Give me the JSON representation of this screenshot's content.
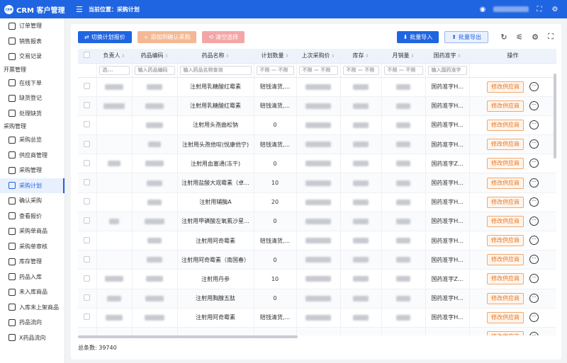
{
  "app": {
    "title": "CRM 客户管理",
    "logo_text": "CRM"
  },
  "breadcrumb": "当前位置：采购计划",
  "sidebar": {
    "top_items": [
      {
        "label": "订单管理",
        "name": "sidebar-item-order-management"
      },
      {
        "label": "销售报表",
        "name": "sidebar-item-sales-report"
      },
      {
        "label": "交易记录",
        "name": "sidebar-item-transaction-records"
      }
    ],
    "group1": "开票管理",
    "group1_items": [
      {
        "label": "在线下单",
        "name": "sidebar-item-online-order"
      },
      {
        "label": "缺货登记",
        "name": "sidebar-item-stockout-register"
      },
      {
        "label": "处理缺货",
        "name": "sidebar-item-handle-stockout"
      }
    ],
    "group2": "采购管理",
    "group2_items": [
      {
        "label": "采购总览",
        "name": "sidebar-item-purchase-overview"
      },
      {
        "label": "供应商管理",
        "name": "sidebar-item-supplier-management"
      },
      {
        "label": "采购管理",
        "name": "sidebar-item-purchase-management"
      },
      {
        "label": "采购计划",
        "name": "sidebar-item-purchase-plan",
        "active": true
      },
      {
        "label": "确认采购",
        "name": "sidebar-item-confirm-purchase"
      },
      {
        "label": "查看报价",
        "name": "sidebar-item-view-quotes"
      },
      {
        "label": "采购单商品",
        "name": "sidebar-item-purchase-order-goods"
      },
      {
        "label": "采购单审核",
        "name": "sidebar-item-purchase-order-review"
      },
      {
        "label": "库存管理",
        "name": "sidebar-item-inventory"
      },
      {
        "label": "药品入库",
        "name": "sidebar-item-drug-inbound"
      },
      {
        "label": "未入库商品",
        "name": "sidebar-item-not-inbound"
      },
      {
        "label": "入库未上架商品",
        "name": "sidebar-item-inbound-not-shelved"
      },
      {
        "label": "药品流向",
        "name": "sidebar-item-drug-flow"
      },
      {
        "label": "X药品流向",
        "name": "sidebar-item-x-drug-flow"
      }
    ]
  },
  "toolbar": {
    "switch_quote": "切换计划报价",
    "add_confirm": "添加到确认采购",
    "clear_selection": "清空选择",
    "batch_import": "批量导入",
    "batch_export": "批量导出"
  },
  "table": {
    "headers": {
      "owner": "负责人",
      "code": "药品编码",
      "name": "药品名称",
      "plan_qty": "计划数量",
      "last_price": "上次采购价",
      "stock": "库存",
      "monthly_sales": "月销量",
      "approval": "国药准字",
      "ops": "操作"
    },
    "filters": {
      "owner": "选...",
      "code": "输入药品编码",
      "name": "输入药品名称查询",
      "plan_qty": "不限 — 不限",
      "last_price": "不限 — 不限",
      "stock": "不限 — 不限",
      "monthly_sales": "不限 — 不限",
      "approval": "输入国药准字"
    },
    "edit_supplier_label": "修改供应商",
    "more_label": "···",
    "rows": [
      {
        "name": "注射用乳糖酸红霉素",
        "plan_qty": "赔钱清货,...",
        "approval": "国药准字H..."
      },
      {
        "name": "注射用乳糖酸红霉素",
        "plan_qty": "赔钱清货,...",
        "approval": "国药准字H..."
      },
      {
        "name": "注射用头孢曲松钠",
        "plan_qty": "0",
        "approval": "国药准字H..."
      },
      {
        "name": "注射用头孢他啶(悦康他宁)",
        "plan_qty": "赔钱清货,...",
        "approval": "国药准字H..."
      },
      {
        "name": "注射用血塞通(冻干)",
        "plan_qty": "0",
        "approval": "国药准字Z..."
      },
      {
        "name": "注射用盐酸大观霉素（卓...",
        "plan_qty": "10",
        "approval": "国药准字H..."
      },
      {
        "name": "注射用辅酶A",
        "plan_qty": "20",
        "approval": "国药准字H..."
      },
      {
        "name": "注射用甲磺酸左氧氟沙星...",
        "plan_qty": "0",
        "approval": "国药准字H..."
      },
      {
        "name": "注射用阿奇霉素",
        "plan_qty": "赔钱清货,...",
        "approval": "国药准字H..."
      },
      {
        "name": "注射用阿奇霉素（南国春）",
        "plan_qty": "0",
        "approval": "国药准字H..."
      },
      {
        "name": "注射用丹参",
        "plan_qty": "10",
        "approval": "国药准字Z..."
      },
      {
        "name": "注射用胸腺五肽",
        "plan_qty": "0",
        "approval": "国药准字H..."
      },
      {
        "name": "注射用阿奇霉素",
        "plan_qty": "赔钱清货,...",
        "approval": "国药准字H..."
      },
      {
        "name": "",
        "plan_qty": "",
        "approval": ""
      }
    ]
  },
  "footer": {
    "total": "总条数: 39740"
  },
  "colors": {
    "primary": "#1f64e0",
    "warning": "#f5b894",
    "danger": "#f4a6a6",
    "op_border": "#f3a86d"
  }
}
